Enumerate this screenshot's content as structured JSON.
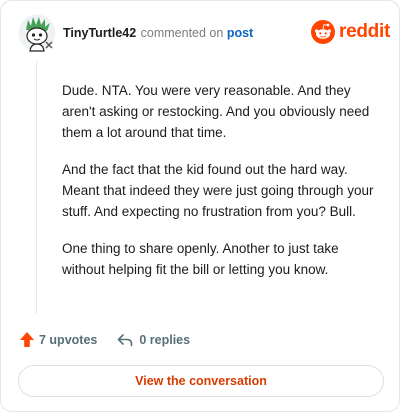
{
  "header": {
    "username": "TinyTurtle42",
    "action_text": "commented on",
    "post_link": "post",
    "brand_word": "reddit"
  },
  "comment": {
    "paragraphs": [
      "Dude. NTA. You were very reasonable. And they aren't asking or restocking. And you obviously need them a lot around that time.",
      "And the fact that the kid found out the hard way. Meant that indeed they were just going through your stuff. And expecting no frustration from you? Bull.",
      "One thing to share openly. Another to just take without helping fit the bill or letting you know."
    ]
  },
  "actions": {
    "upvotes_label": "7 upvotes",
    "replies_label": "0 replies"
  },
  "cta": {
    "label": "View the conversation"
  },
  "colors": {
    "accent": "#ff4500",
    "cta_text": "#d93a00",
    "link": "#0a66c2"
  },
  "icons": {
    "avatar": "snoo-avatar-icon",
    "brand": "reddit-logo-icon",
    "upvote": "upvote-arrow-icon",
    "reply": "reply-arrow-icon"
  }
}
